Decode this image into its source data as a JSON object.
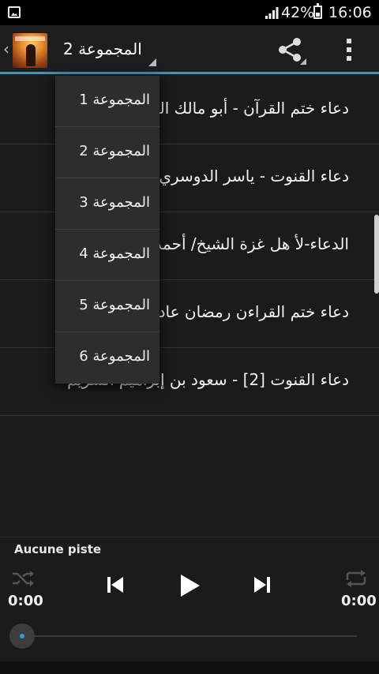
{
  "status_bar": {
    "battery_percent": "42%",
    "time": "16:06",
    "icons": [
      "gallery-notification-icon",
      "signal-icon",
      "battery-icon"
    ]
  },
  "action_bar": {
    "back_glyph": "‹",
    "spinner_selected": "المجموعة 2",
    "icons": [
      "app-icon",
      "share-icon",
      "overflow-menu-icon"
    ]
  },
  "dropdown": {
    "options": [
      "المجموعة 1",
      "المجموعة 2",
      "المجموعة 3",
      "المجموعة 4",
      "المجموعة 5",
      "المجموعة 6"
    ]
  },
  "tracks": [
    {
      "title": "دعاء ختم القرآن - أبو مالك القرشي"
    },
    {
      "title": "دعاء القنوت - ياسر الدوسري"
    },
    {
      "title": "الدعاء-لأ هل غزة الشيخ/ أحمد النقيب"
    },
    {
      "title": "دعاء ختم القراءن رمضان عادل الكلباني..."
    },
    {
      "title": "دعاء القنوت [2] - سعود بن إبراهيم الشريم"
    }
  ],
  "player": {
    "track_name": "Aucune piste",
    "time_elapsed": "0:00",
    "time_total": "0:00",
    "progress": 0,
    "accent_color": "#2a9bd4"
  }
}
